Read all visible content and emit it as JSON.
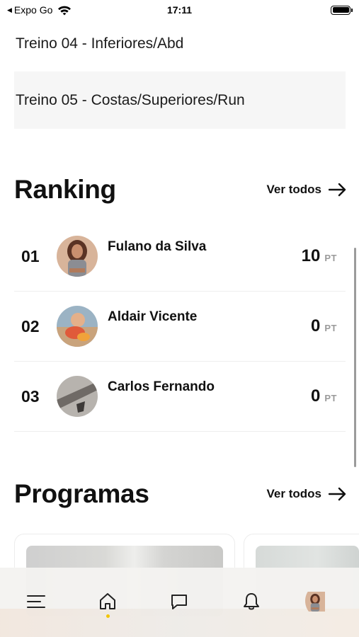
{
  "status_bar": {
    "back_app": "Expo Go",
    "time": "17:11"
  },
  "workouts": [
    {
      "label": "Treino 04 - Inferiores/Abd"
    },
    {
      "label": "Treino 05 - Costas/Superiores/Run"
    }
  ],
  "ranking": {
    "title": "Ranking",
    "see_all": "Ver todos",
    "entries": [
      {
        "position": "01",
        "name": "Fulano da Silva",
        "score": "10",
        "unit": "PT"
      },
      {
        "position": "02",
        "name": "Aldair Vicente",
        "score": "0",
        "unit": "PT"
      },
      {
        "position": "03",
        "name": "Carlos Fernando",
        "score": "0",
        "unit": "PT"
      }
    ]
  },
  "programs": {
    "title": "Programas",
    "see_all": "Ver todos"
  },
  "tab_bar": {
    "items": [
      "menu-icon",
      "home-icon",
      "chat-icon",
      "bell-icon",
      "profile-avatar"
    ],
    "active": "home-icon",
    "active_color": "#f2c500"
  }
}
